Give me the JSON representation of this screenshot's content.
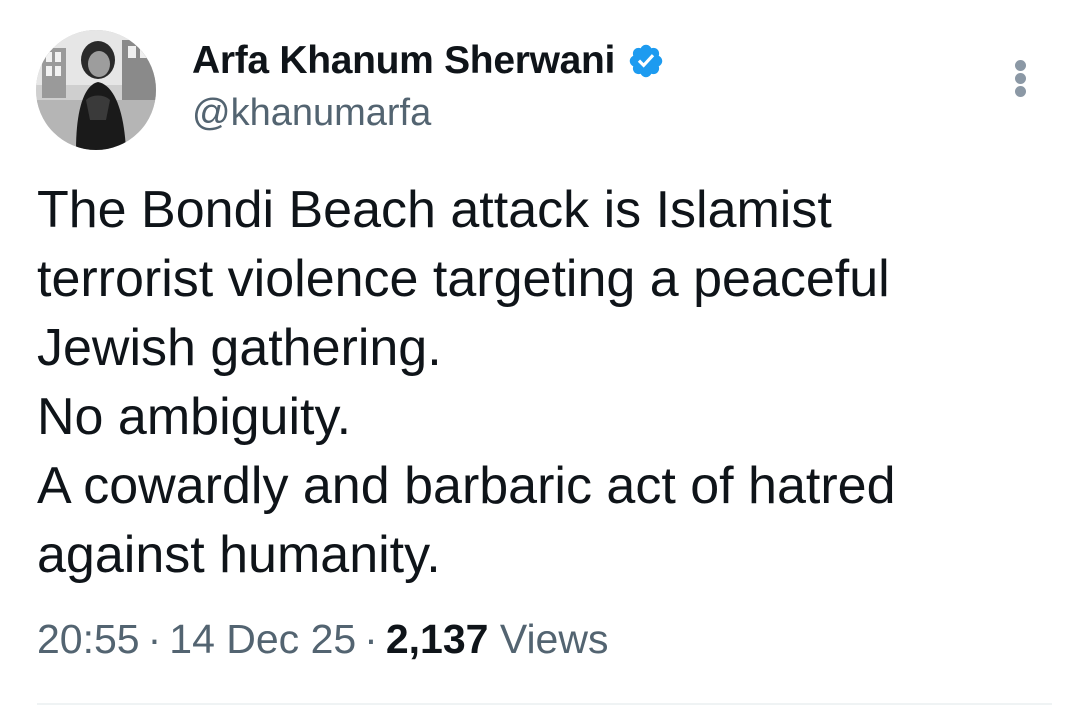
{
  "author": {
    "display_name": "Arfa Khanum Sherwani",
    "handle": "@khanumarfa",
    "verified": true,
    "verified_color": "#1d9bf0",
    "avatar_icon": "profile-photo-avatar"
  },
  "tweet": {
    "lines": [
      "The Bondi Beach attack is Islamist",
      "terrorist violence targeting a peaceful",
      "Jewish gathering.",
      "No ambiguity.",
      "A cowardly and barbaric act of hatred",
      "against humanity."
    ],
    "time": "20:55",
    "date": "14 Dec 25",
    "separator": "·",
    "views_count": "2,137",
    "views_label": "Views"
  },
  "colors": {
    "text": "#0f1419",
    "secondary": "#536471",
    "more_dots": "#8b98a5"
  },
  "icons": {
    "more": "more-vertical-icon",
    "verified": "verified-badge-icon"
  }
}
